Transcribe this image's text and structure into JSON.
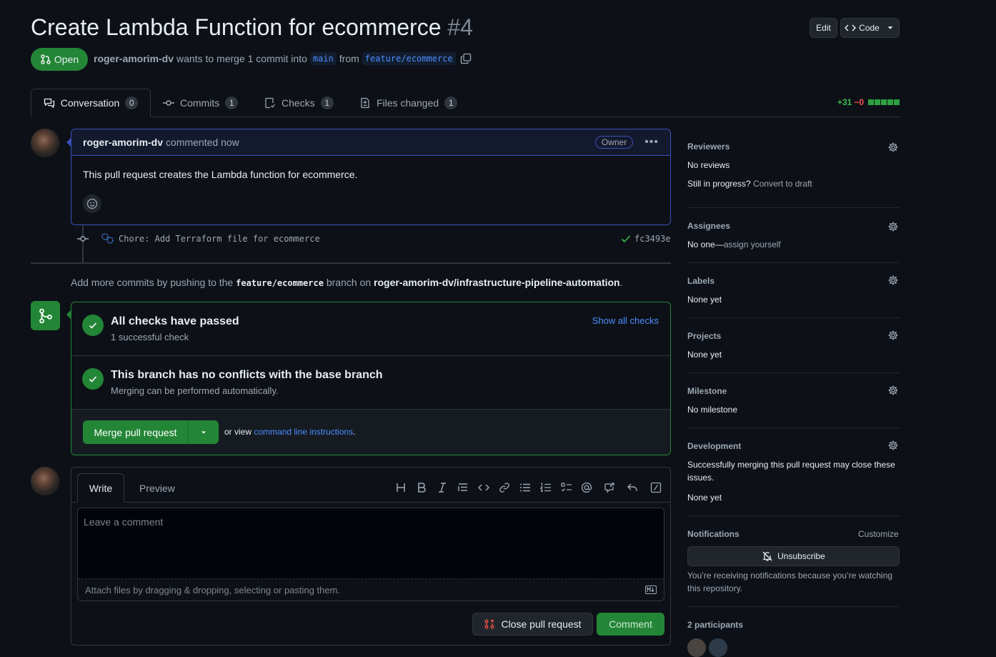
{
  "pr": {
    "title": "Create Lambda Function for ecommerce",
    "number": "#4",
    "state": "Open",
    "author": "roger-amorim-dv",
    "merge_text": "wants to merge 1 commit into",
    "base_branch": "main",
    "from_text": "from",
    "head_branch": "feature/ecommerce"
  },
  "header_buttons": {
    "edit": "Edit",
    "code": "Code"
  },
  "tabs": [
    {
      "label": "Conversation",
      "count": "0"
    },
    {
      "label": "Commits",
      "count": "1"
    },
    {
      "label": "Checks",
      "count": "1"
    },
    {
      "label": "Files changed",
      "count": "1"
    }
  ],
  "diffstat": {
    "additions": "+31",
    "deletions": "−0"
  },
  "comment": {
    "author": "roger-amorim-dv",
    "time": "commented now",
    "badge": "Owner",
    "body": "This pull request creates the Lambda function for ecommerce."
  },
  "commit": {
    "message": "Chore: Add Terraform file for ecommerce",
    "sha": "fc3493e"
  },
  "push_hint": {
    "prefix": "Add more commits by pushing to the",
    "branch": "feature/ecommerce",
    "mid": "branch on",
    "repo": "roger-amorim-dv/infrastructure-pipeline-automation",
    "suffix": "."
  },
  "merge_box": {
    "checks_title": "All checks have passed",
    "checks_sub": "1 successful check",
    "show_all": "Show all checks",
    "conflicts_title": "This branch has no conflicts with the base branch",
    "conflicts_sub": "Merging can be performed automatically.",
    "merge_button": "Merge pull request",
    "or_view": "or view",
    "cli_link": "command line instructions",
    "cli_suffix": "."
  },
  "composer": {
    "tab_write": "Write",
    "tab_preview": "Preview",
    "placeholder": "Leave a comment",
    "attach_hint": "Attach files by dragging & dropping, selecting or pasting them.",
    "close_button": "Close pull request",
    "comment_button": "Comment"
  },
  "sidebar": {
    "reviewers": {
      "title": "Reviewers",
      "value": "No reviews",
      "progress_q": "Still in progress?",
      "convert": "Convert to draft"
    },
    "assignees": {
      "title": "Assignees",
      "value": "No one—",
      "assign": "assign yourself"
    },
    "labels": {
      "title": "Labels",
      "value": "None yet"
    },
    "projects": {
      "title": "Projects",
      "value": "None yet"
    },
    "milestone": {
      "title": "Milestone",
      "value": "No milestone"
    },
    "development": {
      "title": "Development",
      "line1": "Successfully merging this pull request may close these",
      "line2": "issues.",
      "value": "None yet"
    },
    "notifications": {
      "title": "Notifications",
      "customize": "Customize",
      "button": "Unsubscribe",
      "line1": "You’re receiving notifications because you’re watching",
      "line2": "this repository."
    },
    "participants": {
      "title": "2 participants"
    }
  },
  "colors": {
    "accent_green": "#238636",
    "link_blue": "#4c8dff",
    "danger_red": "#f85149",
    "bg": "#0d1117"
  }
}
